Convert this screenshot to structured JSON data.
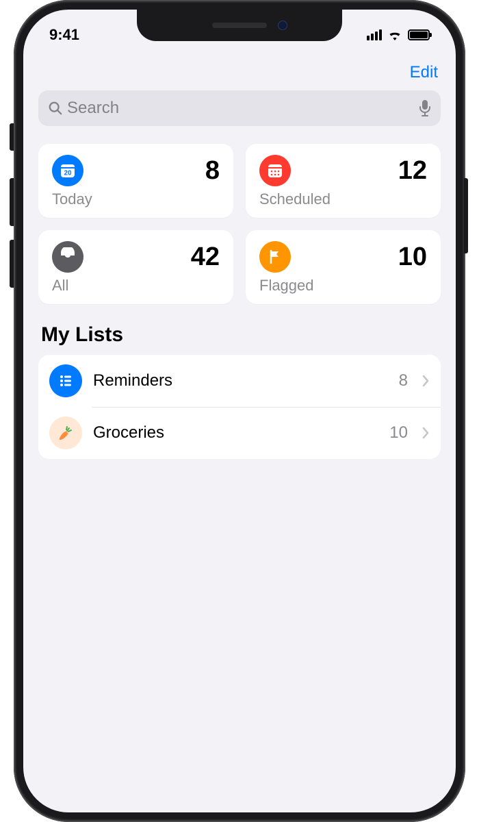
{
  "status": {
    "time": "9:41"
  },
  "nav": {
    "edit": "Edit"
  },
  "search": {
    "placeholder": "Search"
  },
  "cards": [
    {
      "id": "today",
      "label": "Today",
      "count": 8,
      "color": "#007aff",
      "icon": "calendar-today-icon"
    },
    {
      "id": "scheduled",
      "label": "Scheduled",
      "count": 12,
      "color": "#ff3b30",
      "icon": "calendar-icon"
    },
    {
      "id": "all",
      "label": "All",
      "count": 42,
      "color": "#5b5b60",
      "icon": "tray-icon"
    },
    {
      "id": "flagged",
      "label": "Flagged",
      "count": 10,
      "color": "#ff9500",
      "icon": "flag-icon"
    }
  ],
  "lists": {
    "header": "My Lists",
    "items": [
      {
        "name": "Reminders",
        "count": 8,
        "icon": "list-bullet-icon",
        "color": "#007aff"
      },
      {
        "name": "Groceries",
        "count": 10,
        "icon": "carrot-icon",
        "color": "#ffe9d6"
      }
    ]
  }
}
